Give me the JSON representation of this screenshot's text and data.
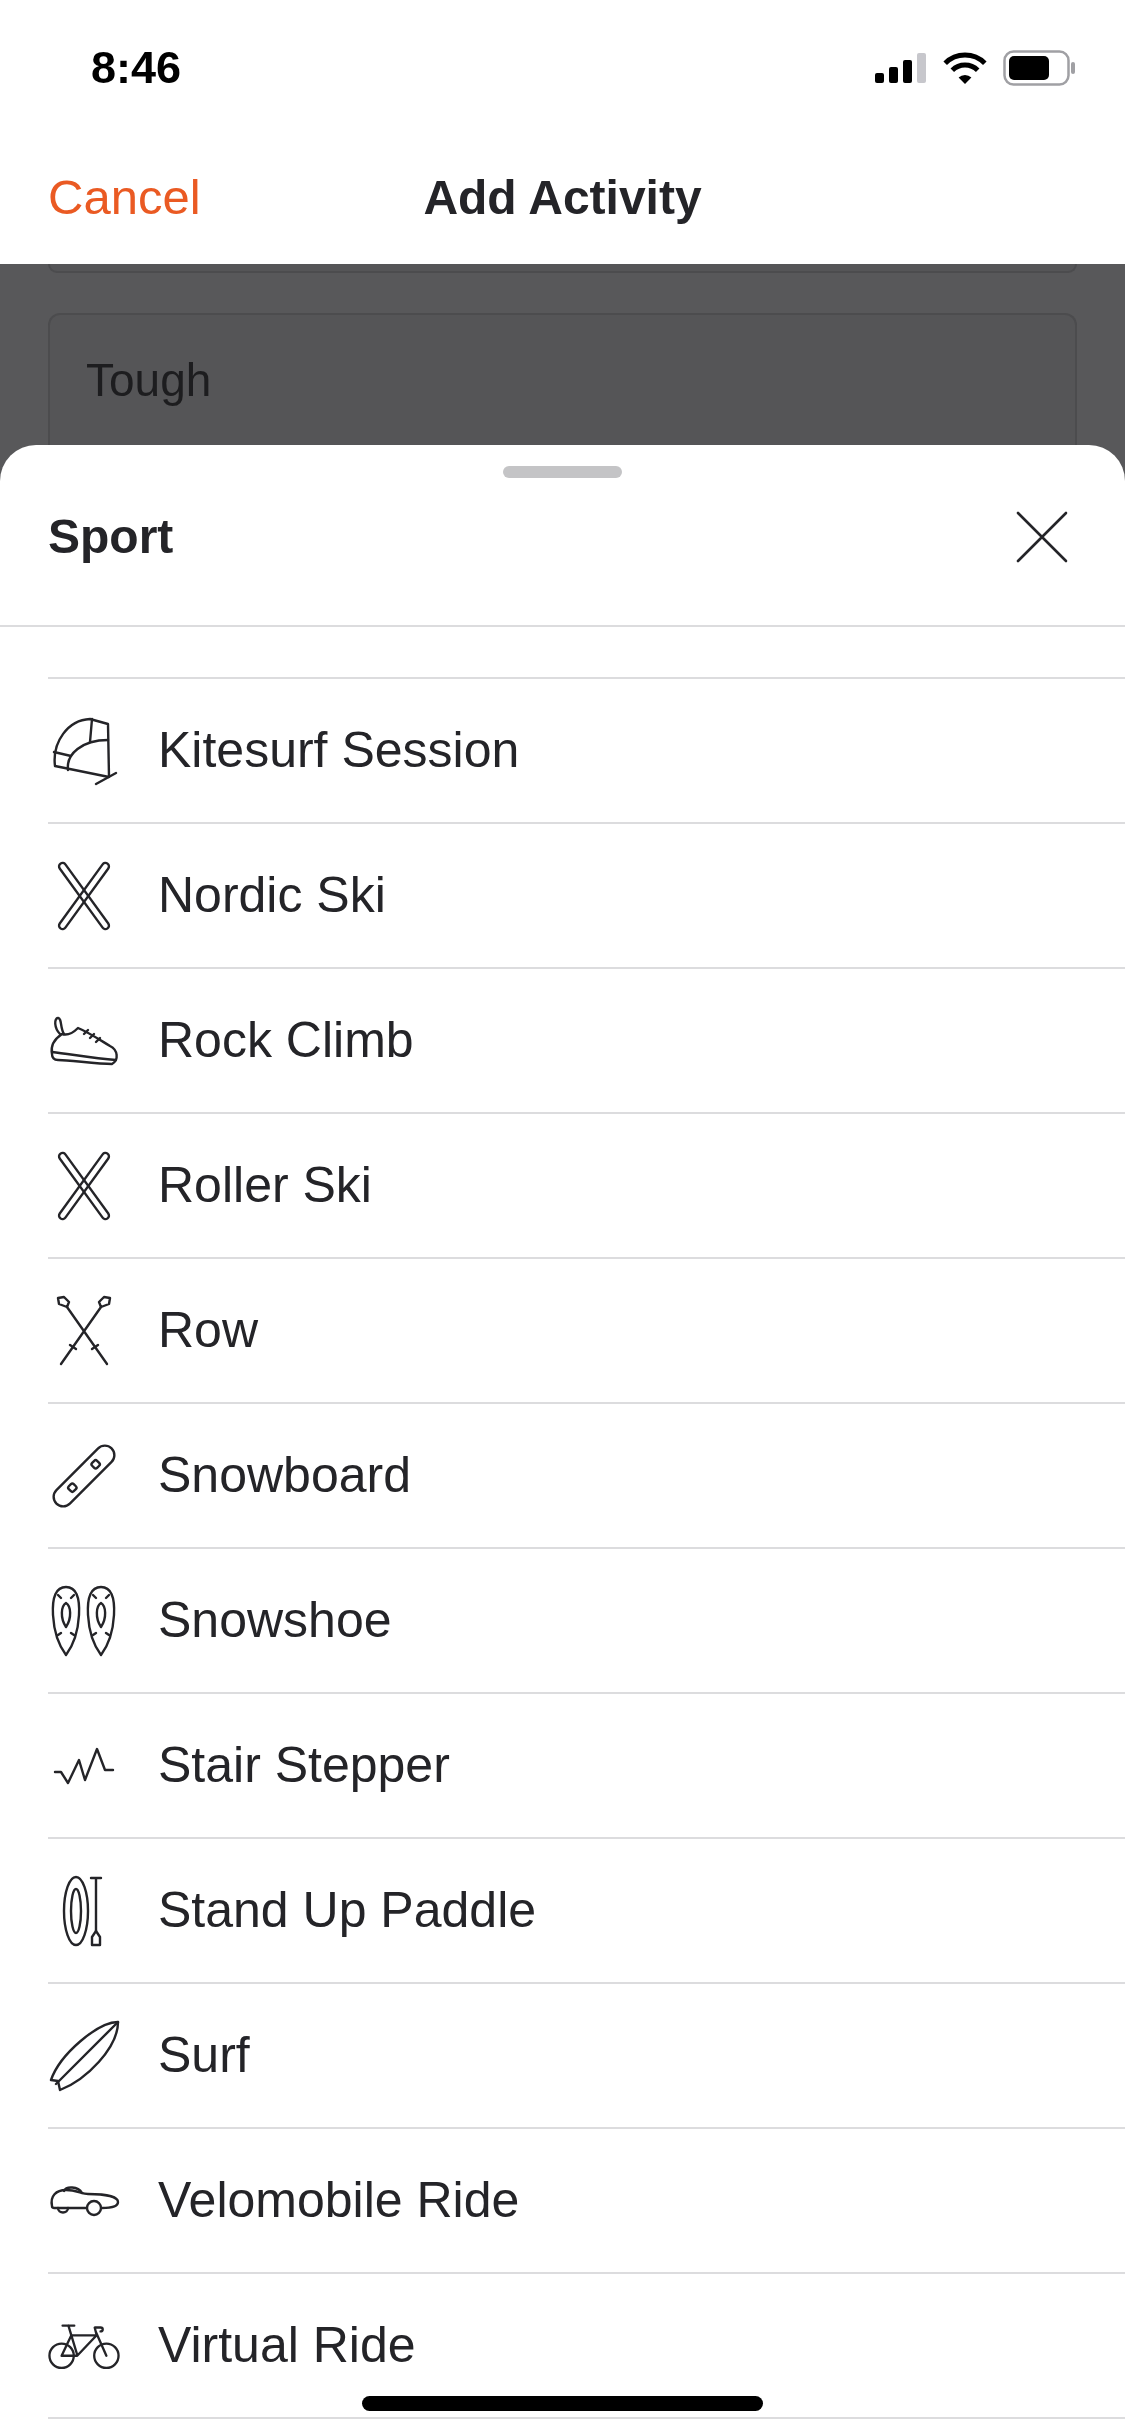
{
  "status_bar": {
    "time": "8:46"
  },
  "nav_bar": {
    "cancel": "Cancel",
    "title": "Add Activity"
  },
  "form": {
    "fields": [
      {
        "value": "Tough"
      }
    ]
  },
  "sheet": {
    "title": "Sport",
    "items": [
      {
        "label": "Kitesurf Session",
        "kind": "kite"
      },
      {
        "label": "Nordic Ski",
        "kind": "skis"
      },
      {
        "label": "Rock Climb",
        "kind": "shoe"
      },
      {
        "label": "Roller Ski",
        "kind": "skis"
      },
      {
        "label": "Row",
        "kind": "oars"
      },
      {
        "label": "Snowboard",
        "kind": "snowboard"
      },
      {
        "label": "Snowshoe",
        "kind": "snowshoes"
      },
      {
        "label": "Stair Stepper",
        "kind": "zigzag"
      },
      {
        "label": "Stand Up Paddle",
        "kind": "paddleboard"
      },
      {
        "label": "Surf",
        "kind": "surfboard"
      },
      {
        "label": "Velomobile Ride",
        "kind": "velomobile"
      },
      {
        "label": "Virtual Ride",
        "kind": "bicycle"
      }
    ]
  }
}
